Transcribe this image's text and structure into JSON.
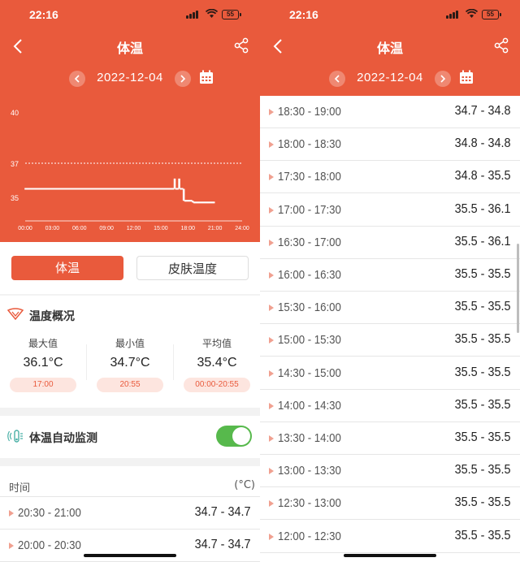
{
  "status": {
    "time": "22:16",
    "battery": "55"
  },
  "nav": {
    "title": "体温"
  },
  "date": "2022-12-04",
  "chart_data": {
    "type": "line",
    "title": "",
    "y_ticks": [
      "40",
      "37",
      "35"
    ],
    "x_ticks": [
      "00:00",
      "03:00",
      "06:00",
      "09:00",
      "12:00",
      "15:00",
      "18:00",
      "21:00",
      "24:00"
    ],
    "reference_line": 37,
    "series": [
      {
        "x": [
          "00:00",
          "00:30",
          "01:00",
          "01:30",
          "02:00",
          "02:30",
          "03:00",
          "03:30",
          "04:00",
          "04:30",
          "05:00",
          "05:30",
          "06:00",
          "06:30",
          "07:00",
          "07:30",
          "08:00",
          "08:30",
          "09:00",
          "09:30",
          "10:00",
          "10:30",
          "11:00",
          "11:30",
          "12:00",
          "12:30",
          "13:00",
          "13:30",
          "14:00",
          "14:30",
          "15:00",
          "15:30",
          "16:00",
          "16:30",
          "17:00",
          "17:30",
          "18:00",
          "18:30",
          "19:00",
          "19:30",
          "20:00",
          "20:30"
        ],
        "low": [
          35.5,
          35.5,
          35.5,
          35.5,
          35.5,
          35.5,
          35.5,
          35.5,
          35.5,
          35.5,
          35.5,
          35.5,
          35.5,
          35.5,
          35.5,
          35.5,
          35.5,
          35.5,
          35.5,
          35.5,
          35.5,
          35.5,
          35.5,
          35.5,
          35.5,
          35.5,
          35.5,
          35.5,
          35.5,
          35.5,
          35.5,
          35.5,
          35.5,
          35.5,
          35.5,
          34.8,
          34.8,
          34.7,
          34.7,
          34.7,
          34.7,
          34.7
        ],
        "high": [
          35.5,
          35.5,
          35.5,
          35.5,
          35.5,
          35.5,
          35.5,
          35.5,
          35.5,
          35.5,
          35.5,
          35.5,
          35.5,
          35.5,
          35.5,
          35.5,
          35.5,
          35.5,
          35.5,
          35.5,
          35.5,
          35.5,
          35.5,
          35.5,
          35.5,
          35.5,
          35.5,
          35.5,
          35.5,
          35.5,
          35.5,
          35.5,
          35.5,
          36.1,
          36.1,
          35.5,
          34.8,
          34.8,
          34.7,
          34.7,
          34.7,
          34.7
        ]
      }
    ],
    "ylim": [
      34,
      41
    ]
  },
  "tabs": {
    "active": "体温",
    "other": "皮肤温度"
  },
  "overview": {
    "title": "温度概况",
    "stats": [
      {
        "label": "最大值",
        "value": "36.1°C",
        "time": "17:00"
      },
      {
        "label": "最小值",
        "value": "34.7°C",
        "time": "20:55"
      },
      {
        "label": "平均值",
        "value": "35.4°C",
        "time": "00:00-20:55"
      }
    ]
  },
  "auto_monitor": {
    "label": "体温自动监测",
    "enabled": true
  },
  "list": {
    "header_time": "时间",
    "header_unit": "(°C)",
    "left_rows": [
      {
        "range": "20:30 - 21:00",
        "temp": "34.7 - 34.7"
      },
      {
        "range": "20:00 - 20:30",
        "temp": "34.7 - 34.7"
      }
    ],
    "right_rows": [
      {
        "range": "18:30 - 19:00",
        "temp": "34.7 - 34.8"
      },
      {
        "range": "18:00 - 18:30",
        "temp": "34.8 - 34.8"
      },
      {
        "range": "17:30 - 18:00",
        "temp": "34.8 - 35.5"
      },
      {
        "range": "17:00 - 17:30",
        "temp": "35.5 - 36.1"
      },
      {
        "range": "16:30 - 17:00",
        "temp": "35.5 - 36.1"
      },
      {
        "range": "16:00 - 16:30",
        "temp": "35.5 - 35.5"
      },
      {
        "range": "15:30 - 16:00",
        "temp": "35.5 - 35.5"
      },
      {
        "range": "15:00 - 15:30",
        "temp": "35.5 - 35.5"
      },
      {
        "range": "14:30 - 15:00",
        "temp": "35.5 - 35.5"
      },
      {
        "range": "14:00 - 14:30",
        "temp": "35.5 - 35.5"
      },
      {
        "range": "13:30 - 14:00",
        "temp": "35.5 - 35.5"
      },
      {
        "range": "13:00 - 13:30",
        "temp": "35.5 - 35.5"
      },
      {
        "range": "12:30 - 13:00",
        "temp": "35.5 - 35.5"
      },
      {
        "range": "12:00 - 12:30",
        "temp": "35.5 - 35.5"
      }
    ]
  },
  "colors": {
    "accent": "#e95a3c",
    "toggle": "#57b94c",
    "pill_bg": "#fde5df"
  },
  "icons": [
    "back-icon",
    "share-icon",
    "calendar-icon",
    "prev-date-icon",
    "next-date-icon",
    "thermometer-wave-icon",
    "monitor-icon",
    "wifi-icon",
    "signal-icon",
    "battery-icon"
  ]
}
